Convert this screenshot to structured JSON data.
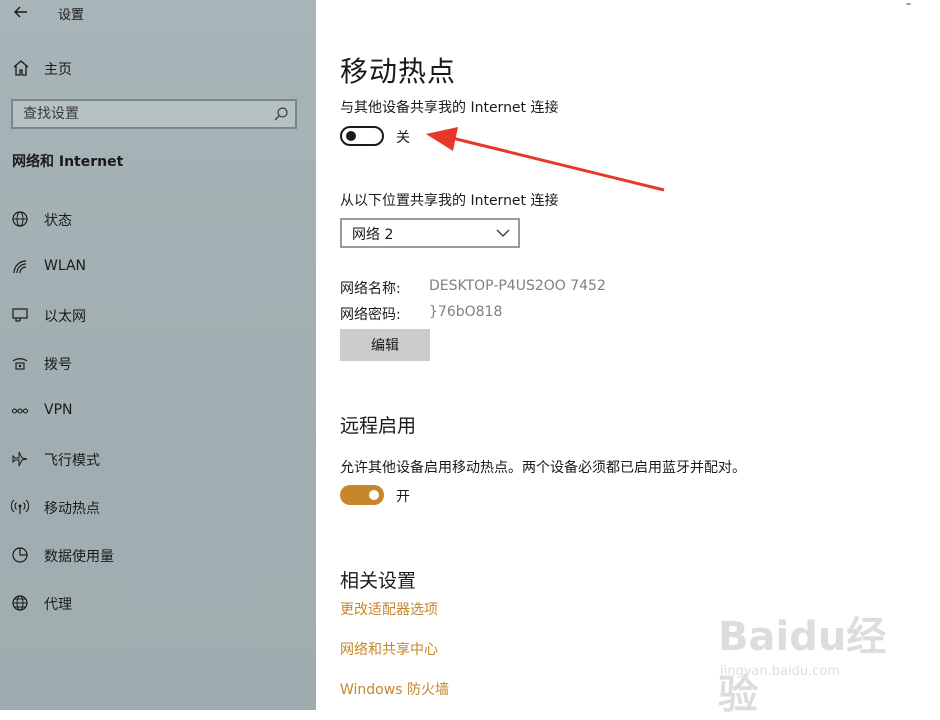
{
  "window": {
    "title": "设置",
    "close_glyph": "ˉ"
  },
  "sidebar": {
    "home_label": "主页",
    "search_placeholder": "查找设置",
    "section_title": "网络和 Internet",
    "items": [
      {
        "label": "状态",
        "icon": "status-globe-icon"
      },
      {
        "label": "WLAN",
        "icon": "wifi-icon"
      },
      {
        "label": "以太网",
        "icon": "ethernet-icon"
      },
      {
        "label": "拨号",
        "icon": "dialup-icon"
      },
      {
        "label": "VPN",
        "icon": "vpn-icon"
      },
      {
        "label": "飞行模式",
        "icon": "airplane-icon"
      },
      {
        "label": "移动热点",
        "icon": "hotspot-icon"
      },
      {
        "label": "数据使用量",
        "icon": "data-usage-icon"
      },
      {
        "label": "代理",
        "icon": "proxy-globe-icon"
      }
    ]
  },
  "main": {
    "title": "移动热点",
    "share_label": "与其他设备共享我的 Internet 连接",
    "share_toggle_state": "关",
    "share_from_label": "从以下位置共享我的 Internet 连接",
    "share_from_value": "网络 2",
    "network_name_label": "网络名称:",
    "network_name_value": "DESKTOP-P4US2OO 7452",
    "network_password_label": "网络密码:",
    "network_password_value": "}76bO818",
    "edit_button": "编辑",
    "remote_heading": "远程启用",
    "remote_desc": "允许其他设备启用移动热点。两个设备必须都已启用蓝牙并配对。",
    "remote_toggle_state": "开",
    "related_heading": "相关设置",
    "links": [
      "更改适配器选项",
      "网络和共享中心",
      "Windows 防火墙"
    ]
  },
  "watermark": {
    "brand": "Baidu经验",
    "url": "jingyan.baidu.com"
  },
  "colors": {
    "accent": "#c7862a",
    "sidebar_bg": "#a4b1b4",
    "arrow": "#e8362b"
  }
}
